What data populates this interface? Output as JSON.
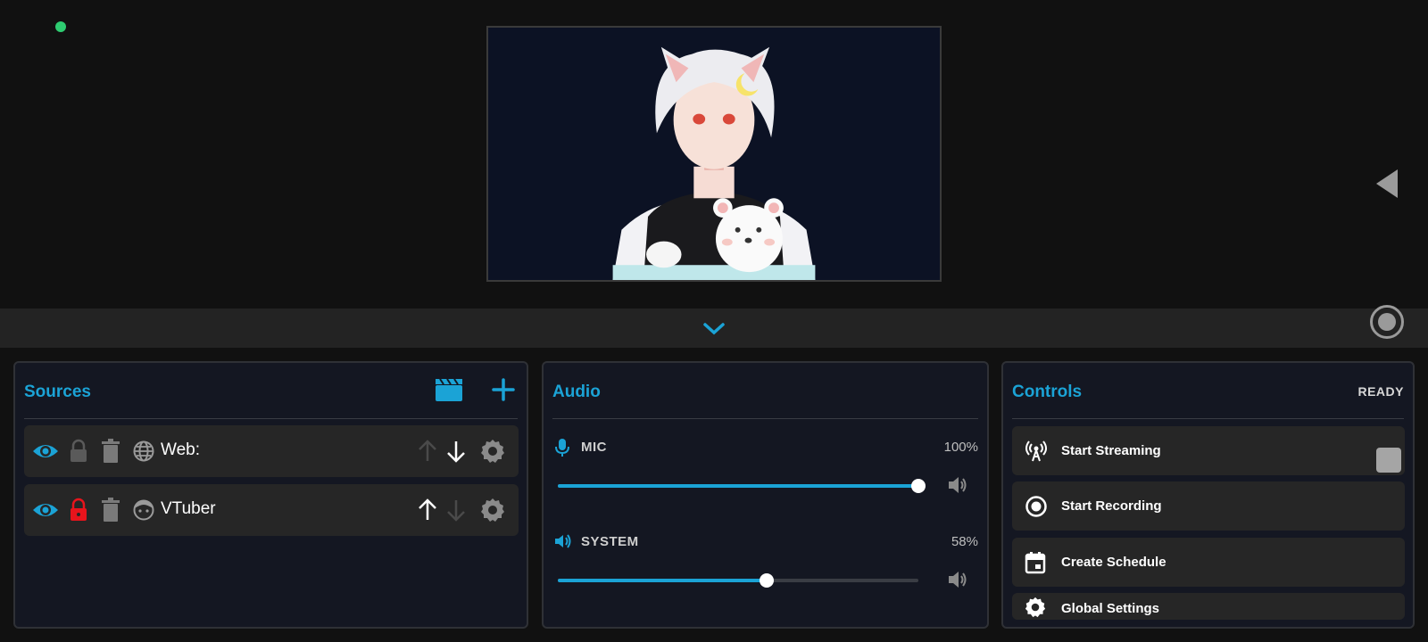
{
  "icons": {
    "status": "status-dot-green",
    "side_toggle": "triangle-left-icon",
    "record_indicator": "record-circle-icon",
    "collapse": "chevron-down-icon"
  },
  "colors": {
    "accent": "#1ba3d6",
    "background": "#111111",
    "panel": "#141722",
    "status_ok": "#2ecc71",
    "lock_active": "#e8141c"
  },
  "sources": {
    "title": "Sources",
    "header_buttons": [
      "clapperboard-icon",
      "plus-icon"
    ],
    "items": [
      {
        "name": "Web:",
        "type_icon": "globe-icon",
        "visible": true,
        "locked": false,
        "up_enabled": false,
        "down_enabled": true
      },
      {
        "name": "VTuber",
        "type_icon": "face-icon",
        "visible": true,
        "locked": true,
        "up_enabled": true,
        "down_enabled": false
      }
    ]
  },
  "audio": {
    "title": "Audio",
    "channels": [
      {
        "label": "MIC",
        "percent": "100%",
        "level": 1.0,
        "icon": "mic-icon"
      },
      {
        "label": "SYSTEM",
        "percent": "58%",
        "level": 0.58,
        "icon": "speaker-icon"
      }
    ]
  },
  "controls": {
    "title": "Controls",
    "status": "READY",
    "buttons": [
      {
        "label": "Start Streaming",
        "icon": "broadcast-icon"
      },
      {
        "label": "Start Recording",
        "icon": "record-icon"
      },
      {
        "label": "Create Schedule",
        "icon": "calendar-icon"
      },
      {
        "label": "Global Settings",
        "icon": "gear-icon"
      }
    ]
  }
}
